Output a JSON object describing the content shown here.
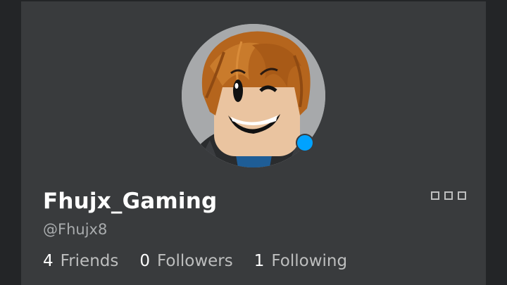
{
  "profile": {
    "display_name": "Fhujx_Gaming",
    "username": "@Fhujx8",
    "presence_color": "#00a2ff",
    "avatar_icon": "avatar-headshot"
  },
  "stats": [
    {
      "count": "4",
      "label": "Friends"
    },
    {
      "count": "0",
      "label": "Followers"
    },
    {
      "count": "1",
      "label": "Following"
    }
  ],
  "more_menu": {
    "icon": "more-options-icon"
  },
  "colors": {
    "page_bg": "#232527",
    "card_bg": "#393b3d",
    "text_primary": "#ffffff",
    "text_secondary": "#a9acae"
  }
}
